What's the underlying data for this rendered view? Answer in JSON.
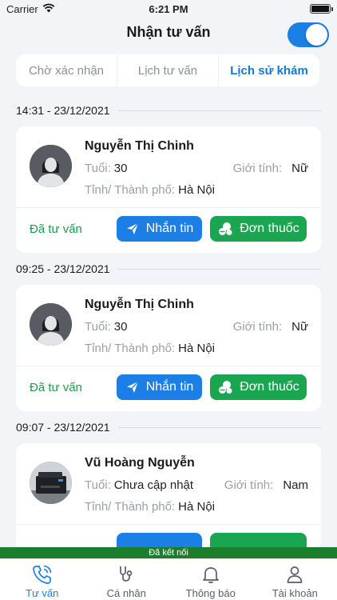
{
  "status_bar": {
    "carrier": "Carrier",
    "time": "6:21 PM"
  },
  "header": {
    "title": "Nhận tư vấn"
  },
  "segments": [
    {
      "label": "Chờ xác nhận"
    },
    {
      "label": "Lịch tư vấn"
    },
    {
      "label": "Lịch sử khám"
    }
  ],
  "labels": {
    "age": "Tuổi:",
    "gender": "Giới tính:",
    "city": "Tỉnh/ Thành phố:"
  },
  "buttons": {
    "message": "Nhắn tin",
    "prescription": "Đơn thuốc"
  },
  "consults": [
    {
      "datetime": "14:31 - 23/12/2021",
      "name": "Nguyễn Thị Chinh",
      "age": "30",
      "gender": "Nữ",
      "city": "Hà Nội",
      "status": "Đã tư vấn",
      "avatar": "placeholder"
    },
    {
      "datetime": "09:25 - 23/12/2021",
      "name": "Nguyễn Thị Chinh",
      "age": "30",
      "gender": "Nữ",
      "city": "Hà Nội",
      "status": "Đã tư vấn",
      "avatar": "placeholder"
    },
    {
      "datetime": "09:07 - 23/12/2021",
      "name": "Vũ Hoàng Nguyễn",
      "age": "Chưa cập nhật",
      "gender": "Nam",
      "city": "Hà Nội",
      "status": "",
      "avatar": "photo"
    }
  ],
  "connection": {
    "text": "Đã kết nối"
  },
  "tabs": [
    {
      "label": "Tư vấn",
      "icon": "phone-icon"
    },
    {
      "label": "Cá nhân",
      "icon": "stethoscope-icon"
    },
    {
      "label": "Thông báo",
      "icon": "bell-icon"
    },
    {
      "label": "Tài khoản",
      "icon": "user-icon"
    }
  ],
  "colors": {
    "primary": "#1c7fe6",
    "success": "#1aa650",
    "status_text": "#1d9a4c",
    "connection_bar": "#1a7f2b"
  }
}
